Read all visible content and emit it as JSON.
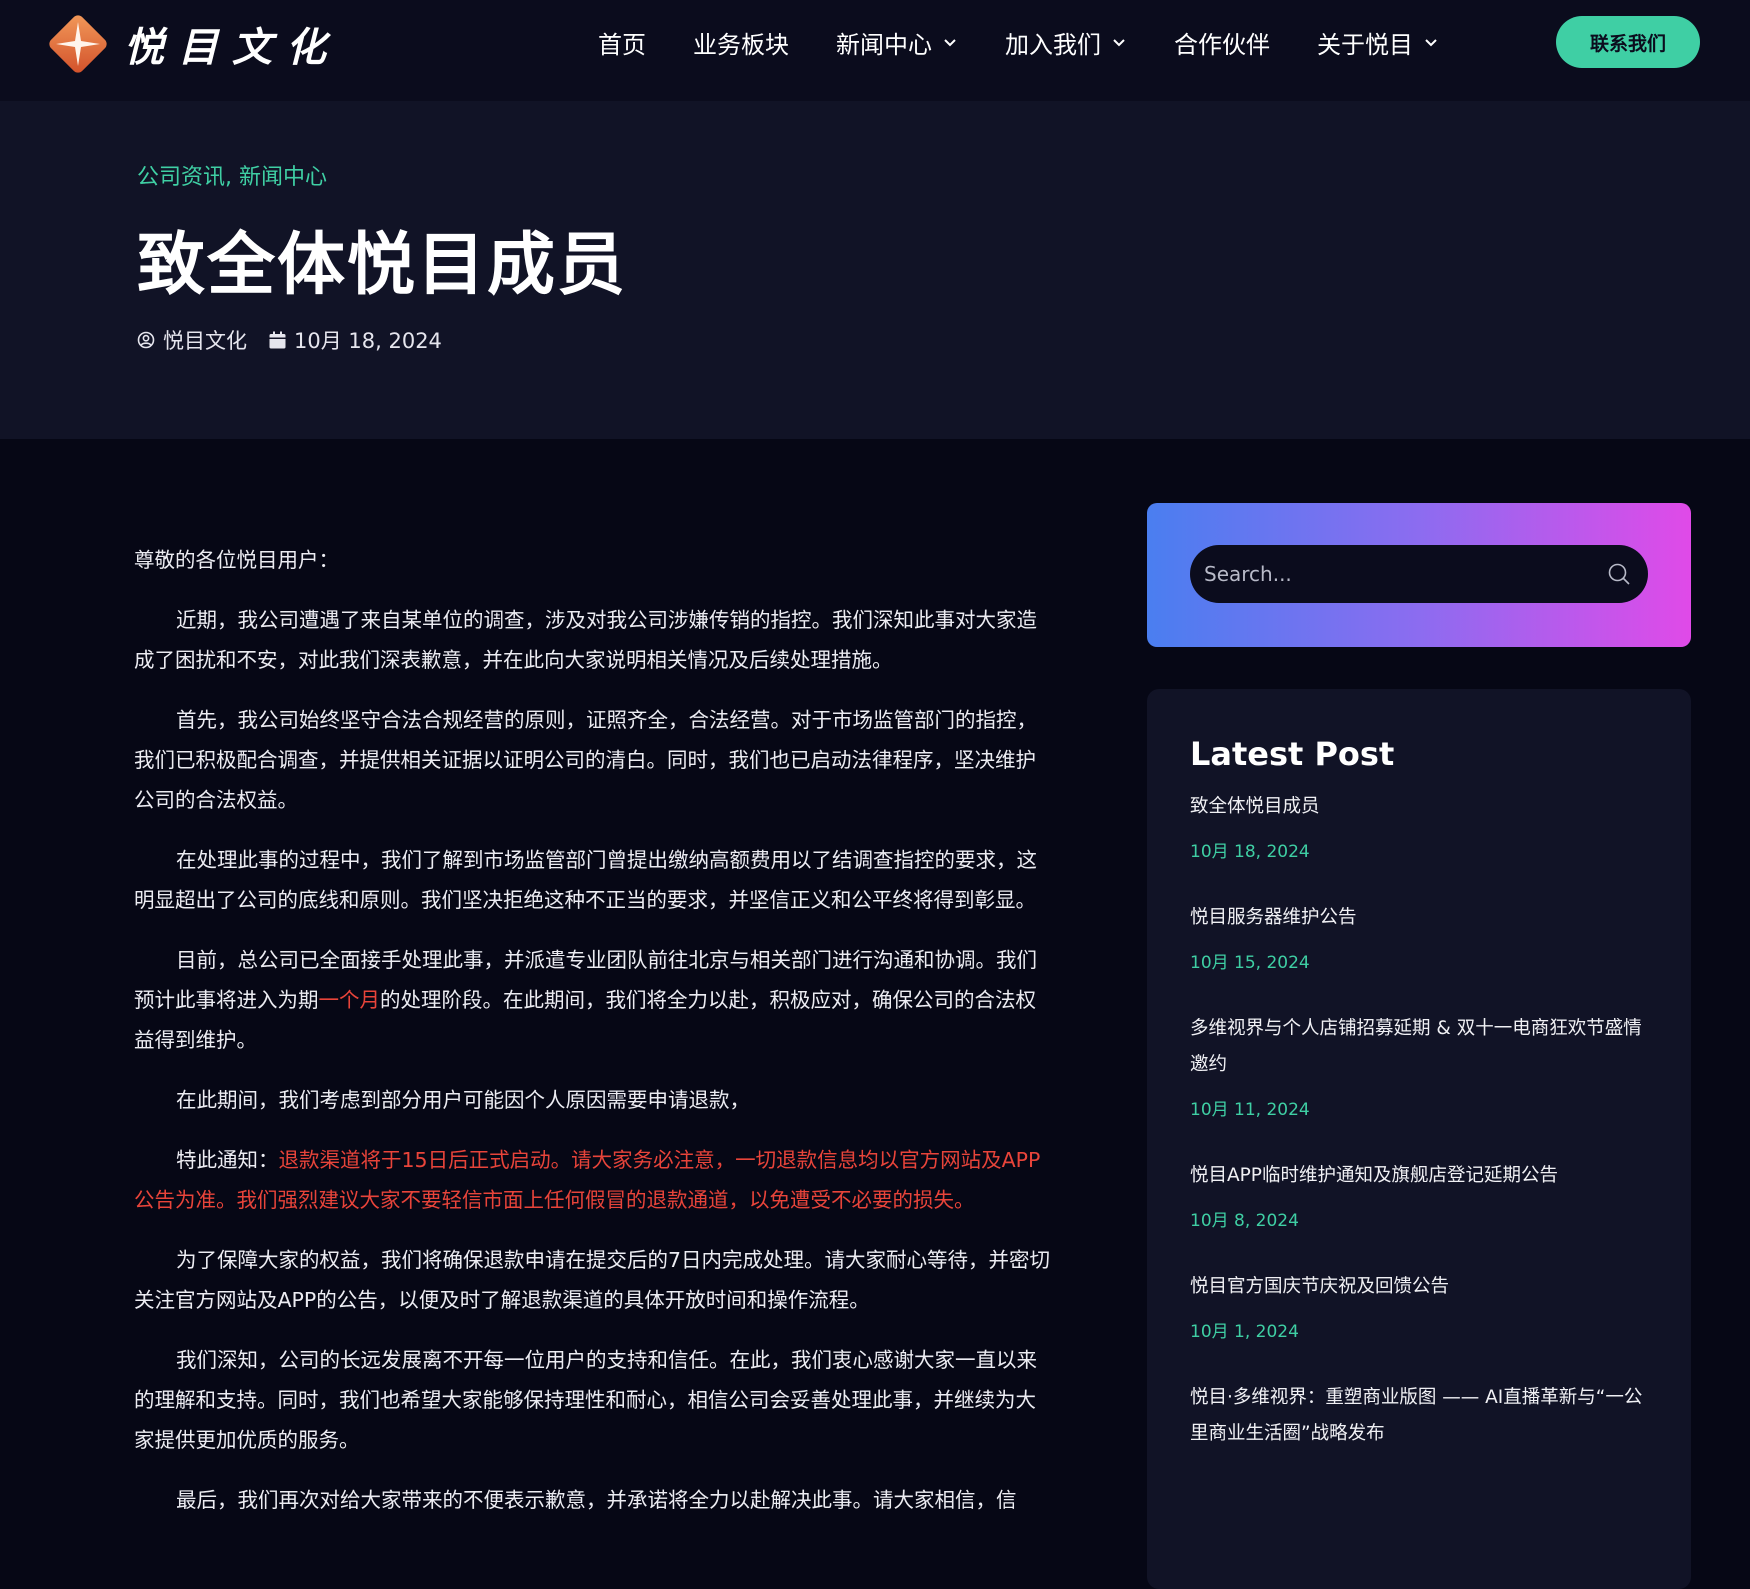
{
  "brand": {
    "name": "悦目文化"
  },
  "nav": {
    "items": [
      {
        "label": "首页",
        "dropdown": false
      },
      {
        "label": "业务板块",
        "dropdown": false
      },
      {
        "label": "新闻中心",
        "dropdown": true
      },
      {
        "label": "加入我们",
        "dropdown": true
      },
      {
        "label": "合作伙伴",
        "dropdown": false
      },
      {
        "label": "关于悦目",
        "dropdown": true
      }
    ],
    "contact_label": "联系我们"
  },
  "hero": {
    "categories": "公司资讯, 新闻中心",
    "title": "致全体悦目成员",
    "author": "悦目文化",
    "date": "10月 18, 2024"
  },
  "article": {
    "greeting": "尊敬的各位悦目用户：",
    "p1": "近期，我公司遭遇了来自某单位的调查，涉及对我公司涉嫌传销的指控。我们深知此事对大家造成了困扰和不安，对此我们深表歉意，并在此向大家说明相关情况及后续处理措施。",
    "p2": "首先，我公司始终坚守合法合规经营的原则，证照齐全，合法经营。对于市场监管部门的指控，我们已积极配合调查，并提供相关证据以证明公司的清白。同时，我们也已启动法律程序，坚决维护公司的合法权益。",
    "p3": "在处理此事的过程中，我们了解到市场监管部门曾提出缴纳高额费用以了结调查指控的要求，这明显超出了公司的底线和原则。我们坚决拒绝这种不正当的要求，并坚信正义和公平终将得到彰显。",
    "p4_a": "目前，总公司已全面接手处理此事，并派遣专业团队前往北京与相关部门进行沟通和协调。我们预计此事将进入为期",
    "p4_red": "一个月",
    "p4_b": "的处理阶段。在此期间，我们将全力以赴，积极应对，确保公司的合法权益得到维护。",
    "p5": "在此期间，我们考虑到部分用户可能因个人原因需要申请退款，",
    "p6_a": "特此通知：",
    "p6_red": "退款渠道将于15日后正式启动。请大家务必注意，一切退款信息均以官方网站及APP公告为准。我们强烈建议大家不要轻信市面上任何假冒的退款通道，以免遭受不必要的损失。",
    "p7": "为了保障大家的权益，我们将确保退款申请在提交后的7日内完成处理。请大家耐心等待，并密切关注官方网站及APP的公告，以便及时了解退款渠道的具体开放时间和操作流程。",
    "p8": "我们深知，公司的长远发展离不开每一位用户的支持和信任。在此，我们衷心感谢大家一直以来的理解和支持。同时，我们也希望大家能够保持理性和耐心，相信公司会妥善处理此事，并继续为大家提供更加优质的服务。",
    "p9": "最后，我们再次对给大家带来的不便表示歉意，并承诺将全力以赴解决此事。请大家相信，信"
  },
  "sidebar": {
    "search_placeholder": "Search...",
    "latest_heading": "Latest Post",
    "posts": [
      {
        "title": "致全体悦目成员",
        "date": "10月 18, 2024"
      },
      {
        "title": "悦目服务器维护公告",
        "date": "10月 15, 2024"
      },
      {
        "title": "多维视界与个人店铺招募延期 & 双十一电商狂欢节盛情邀约",
        "date": "10月 11, 2024"
      },
      {
        "title": "悦目APP临时维护通知及旗舰店登记延期公告",
        "date": "10月 8, 2024"
      },
      {
        "title": "悦目官方国庆节庆祝及回馈公告",
        "date": "10月 1, 2024"
      },
      {
        "title": "悦目·多维视界：重塑商业版图 —— AI直播革新与“一公里商业生活圈”战略发布",
        "date": ""
      }
    ]
  },
  "colors": {
    "accent": "#3fcfa4",
    "alert": "#e8443a",
    "bg": "#060715",
    "header": "#0b0c1d"
  }
}
